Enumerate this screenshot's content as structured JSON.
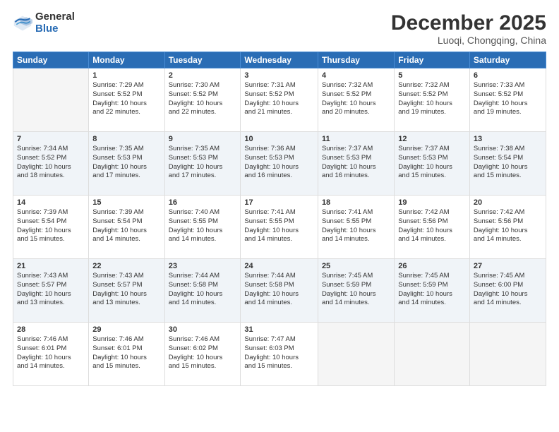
{
  "logo": {
    "general": "General",
    "blue": "Blue"
  },
  "title": "December 2025",
  "subtitle": "Luoqi, Chongqing, China",
  "days_of_week": [
    "Sunday",
    "Monday",
    "Tuesday",
    "Wednesday",
    "Thursday",
    "Friday",
    "Saturday"
  ],
  "weeks": [
    [
      {
        "day": "",
        "info": ""
      },
      {
        "day": "1",
        "info": "Sunrise: 7:29 AM\nSunset: 5:52 PM\nDaylight: 10 hours\nand 22 minutes."
      },
      {
        "day": "2",
        "info": "Sunrise: 7:30 AM\nSunset: 5:52 PM\nDaylight: 10 hours\nand 22 minutes."
      },
      {
        "day": "3",
        "info": "Sunrise: 7:31 AM\nSunset: 5:52 PM\nDaylight: 10 hours\nand 21 minutes."
      },
      {
        "day": "4",
        "info": "Sunrise: 7:32 AM\nSunset: 5:52 PM\nDaylight: 10 hours\nand 20 minutes."
      },
      {
        "day": "5",
        "info": "Sunrise: 7:32 AM\nSunset: 5:52 PM\nDaylight: 10 hours\nand 19 minutes."
      },
      {
        "day": "6",
        "info": "Sunrise: 7:33 AM\nSunset: 5:52 PM\nDaylight: 10 hours\nand 19 minutes."
      }
    ],
    [
      {
        "day": "7",
        "info": "Sunrise: 7:34 AM\nSunset: 5:52 PM\nDaylight: 10 hours\nand 18 minutes."
      },
      {
        "day": "8",
        "info": "Sunrise: 7:35 AM\nSunset: 5:53 PM\nDaylight: 10 hours\nand 17 minutes."
      },
      {
        "day": "9",
        "info": "Sunrise: 7:35 AM\nSunset: 5:53 PM\nDaylight: 10 hours\nand 17 minutes."
      },
      {
        "day": "10",
        "info": "Sunrise: 7:36 AM\nSunset: 5:53 PM\nDaylight: 10 hours\nand 16 minutes."
      },
      {
        "day": "11",
        "info": "Sunrise: 7:37 AM\nSunset: 5:53 PM\nDaylight: 10 hours\nand 16 minutes."
      },
      {
        "day": "12",
        "info": "Sunrise: 7:37 AM\nSunset: 5:53 PM\nDaylight: 10 hours\nand 15 minutes."
      },
      {
        "day": "13",
        "info": "Sunrise: 7:38 AM\nSunset: 5:54 PM\nDaylight: 10 hours\nand 15 minutes."
      }
    ],
    [
      {
        "day": "14",
        "info": "Sunrise: 7:39 AM\nSunset: 5:54 PM\nDaylight: 10 hours\nand 15 minutes."
      },
      {
        "day": "15",
        "info": "Sunrise: 7:39 AM\nSunset: 5:54 PM\nDaylight: 10 hours\nand 14 minutes."
      },
      {
        "day": "16",
        "info": "Sunrise: 7:40 AM\nSunset: 5:55 PM\nDaylight: 10 hours\nand 14 minutes."
      },
      {
        "day": "17",
        "info": "Sunrise: 7:41 AM\nSunset: 5:55 PM\nDaylight: 10 hours\nand 14 minutes."
      },
      {
        "day": "18",
        "info": "Sunrise: 7:41 AM\nSunset: 5:55 PM\nDaylight: 10 hours\nand 14 minutes."
      },
      {
        "day": "19",
        "info": "Sunrise: 7:42 AM\nSunset: 5:56 PM\nDaylight: 10 hours\nand 14 minutes."
      },
      {
        "day": "20",
        "info": "Sunrise: 7:42 AM\nSunset: 5:56 PM\nDaylight: 10 hours\nand 14 minutes."
      }
    ],
    [
      {
        "day": "21",
        "info": "Sunrise: 7:43 AM\nSunset: 5:57 PM\nDaylight: 10 hours\nand 13 minutes."
      },
      {
        "day": "22",
        "info": "Sunrise: 7:43 AM\nSunset: 5:57 PM\nDaylight: 10 hours\nand 13 minutes."
      },
      {
        "day": "23",
        "info": "Sunrise: 7:44 AM\nSunset: 5:58 PM\nDaylight: 10 hours\nand 14 minutes."
      },
      {
        "day": "24",
        "info": "Sunrise: 7:44 AM\nSunset: 5:58 PM\nDaylight: 10 hours\nand 14 minutes."
      },
      {
        "day": "25",
        "info": "Sunrise: 7:45 AM\nSunset: 5:59 PM\nDaylight: 10 hours\nand 14 minutes."
      },
      {
        "day": "26",
        "info": "Sunrise: 7:45 AM\nSunset: 5:59 PM\nDaylight: 10 hours\nand 14 minutes."
      },
      {
        "day": "27",
        "info": "Sunrise: 7:45 AM\nSunset: 6:00 PM\nDaylight: 10 hours\nand 14 minutes."
      }
    ],
    [
      {
        "day": "28",
        "info": "Sunrise: 7:46 AM\nSunset: 6:01 PM\nDaylight: 10 hours\nand 14 minutes."
      },
      {
        "day": "29",
        "info": "Sunrise: 7:46 AM\nSunset: 6:01 PM\nDaylight: 10 hours\nand 15 minutes."
      },
      {
        "day": "30",
        "info": "Sunrise: 7:46 AM\nSunset: 6:02 PM\nDaylight: 10 hours\nand 15 minutes."
      },
      {
        "day": "31",
        "info": "Sunrise: 7:47 AM\nSunset: 6:03 PM\nDaylight: 10 hours\nand 15 minutes."
      },
      {
        "day": "",
        "info": ""
      },
      {
        "day": "",
        "info": ""
      },
      {
        "day": "",
        "info": ""
      }
    ]
  ]
}
